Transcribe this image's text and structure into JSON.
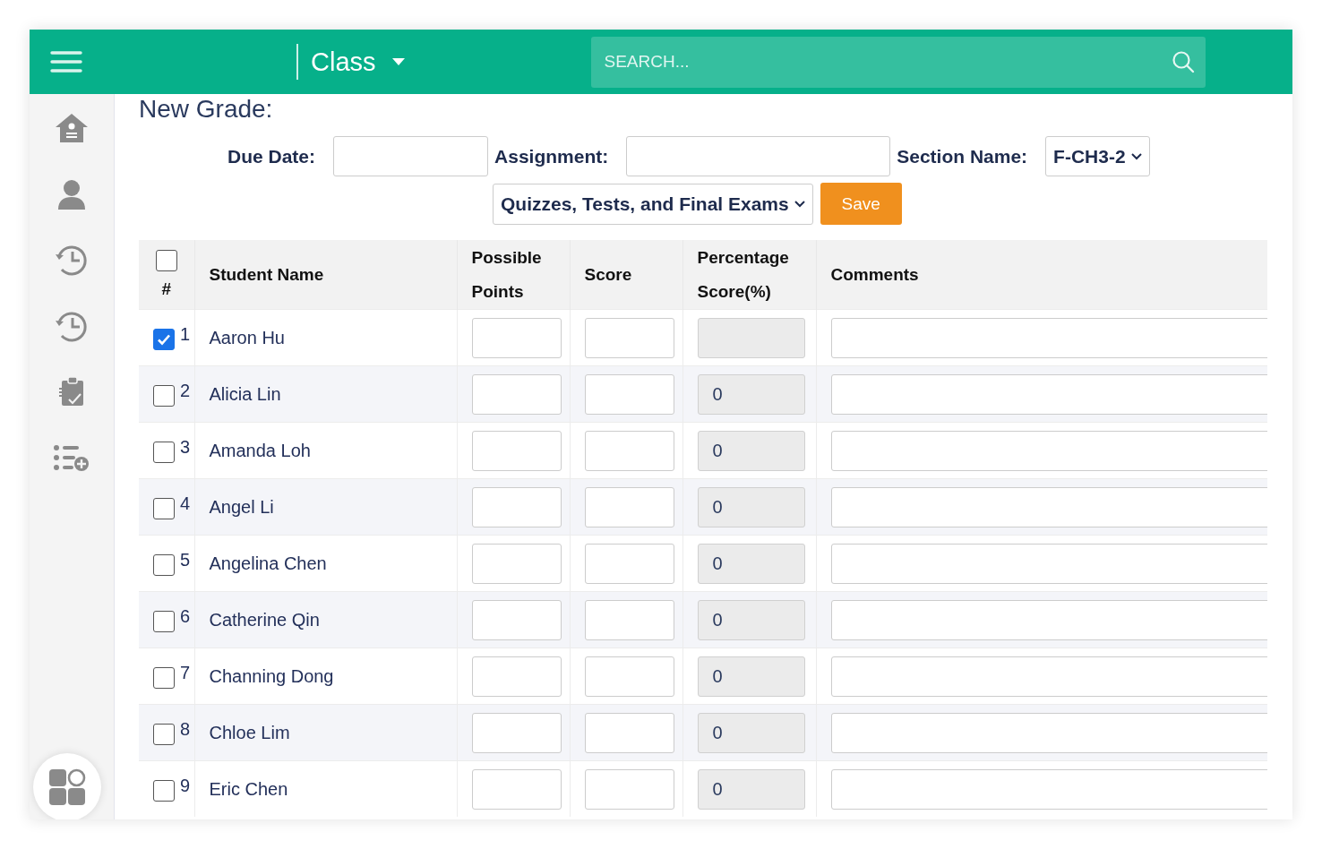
{
  "header": {
    "title": "Class",
    "search": {
      "placeholder": "SEARCH..."
    }
  },
  "page_title": "New Grade:",
  "form": {
    "due_date": {
      "label": "Due Date:"
    },
    "assignment": {
      "label": "Assignment:"
    },
    "section_name": {
      "label": "Section Name:",
      "value": "F-CH3-2"
    },
    "category": {
      "value": "Quizzes, Tests, and Final Exams"
    },
    "save_button": "Save"
  },
  "table": {
    "select_all": {
      "checked": false
    },
    "columns": [
      "#",
      "Student Name",
      "Possible Points",
      "Score",
      "Percentage Score(%)",
      "Comments"
    ],
    "rows": [
      {
        "number": "1",
        "name": "Aaron Hu",
        "checked": true
      },
      {
        "number": "2",
        "name": "Alicia Lin",
        "checked": false,
        "percentage": "0"
      },
      {
        "number": "3",
        "name": "Amanda Loh",
        "checked": false,
        "percentage": "0"
      },
      {
        "number": "4",
        "name": "Angel Li",
        "checked": false,
        "percentage": "0"
      },
      {
        "number": "5",
        "name": "Angelina Chen",
        "checked": false,
        "percentage": "0"
      },
      {
        "number": "6",
        "name": "Catherine Qin",
        "checked": false,
        "percentage": "0"
      },
      {
        "number": "7",
        "name": "Channing Dong",
        "checked": false,
        "percentage": "0"
      },
      {
        "number": "8",
        "name": "Chloe Lim",
        "checked": false,
        "percentage": "0"
      },
      {
        "number": "9",
        "name": "Eric Chen",
        "checked": false,
        "percentage": "0"
      }
    ]
  }
}
